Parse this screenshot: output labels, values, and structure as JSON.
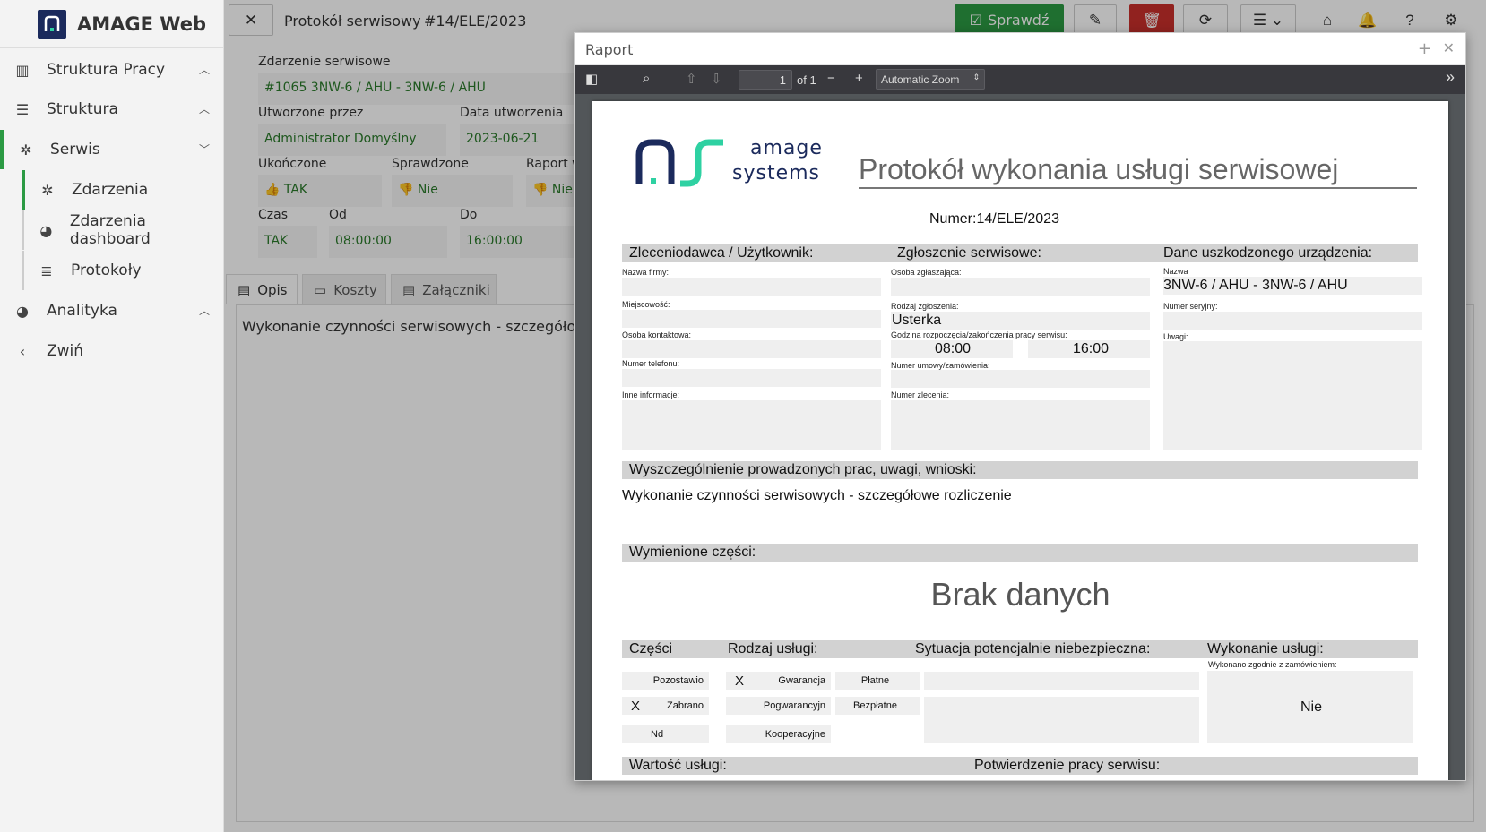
{
  "app": {
    "name": "AMAGE Web"
  },
  "sidebar": {
    "items": [
      {
        "label": "Struktura Pracy"
      },
      {
        "label": "Struktura"
      },
      {
        "label": "Serwis"
      },
      {
        "label": "Zdarzenia"
      },
      {
        "label": "Zdarzenia dashboard"
      },
      {
        "label": "Protokoły"
      },
      {
        "label": "Analityka"
      },
      {
        "label": "Zwiń"
      }
    ]
  },
  "header": {
    "title": "Protokół serwisowy",
    "number": "#14/ELE/2023",
    "check_label": "Sprawdź"
  },
  "form": {
    "event_label": "Zdarzenie serwisowe",
    "event_value": "#1065 3NW-6 / AHU - 3NW-6 / AHU",
    "created_by_label": "Utworzone przez",
    "created_by_value": "Administrator Domyślny",
    "created_date_label": "Data utworzenia",
    "created_date_value": "2023-06-21",
    "finished_label": "Ukończone",
    "finished_value": "TAK",
    "checked_label": "Sprawdzone",
    "checked_value": "Nie",
    "report_label": "Raport w",
    "report_value": "Nie",
    "time_label": "Czas",
    "time_value": "TAK",
    "from_label": "Od",
    "from_value": "08:00:00",
    "to_label": "Do",
    "to_value": "16:00:00"
  },
  "tabs": [
    {
      "label": "Opis"
    },
    {
      "label": "Koszty"
    },
    {
      "label": "Załączniki"
    }
  ],
  "description_text": "Wykonanie czynności serwisowych - szczegółowe r",
  "modal": {
    "title": "Raport",
    "page_input": "1",
    "page_of": "of 1",
    "zoom": "Automatic Zoom"
  },
  "pdf": {
    "logo_top": "amage",
    "logo_bottom": "systems",
    "title": "Protokół wykonania usługi serwisowej",
    "number": "Numer:14/ELE/2023",
    "sec_client": "Zleceniodawca / Użytkownik:",
    "sec_request": "Zgłoszenie serwisowe:",
    "sec_device": "Dane uszkodzonego urządzenia:",
    "company_name": "Nazwa firmy:",
    "city": "Miejscowość:",
    "contact": "Osoba kontaktowa:",
    "phone": "Numer telefonu:",
    "other_info": "Inne informacje:",
    "reporter": "Osoba zgłaszająca:",
    "request_type": "Rodzaj zgłoszenia:",
    "request_type_value": "Usterka",
    "work_hours": "Godzina rozpoczęcia/zakończenia pracy serwisu:",
    "start": "08:00",
    "end": "16:00",
    "contract_no": "Numer umowy/zamówienia:",
    "order_no": "Numer zlecenia:",
    "device_name": "Nazwa",
    "device_name_value": "3NW-6 / AHU - 3NW-6 / AHU",
    "serial": "Numer seryjny:",
    "notes": "Uwagi:",
    "sec_works": "Wyszczególnienie prowadzonych prac, uwagi, wnioski:",
    "works_text": "Wykonanie czynności serwisowych - szczegółowe rozliczenie",
    "sec_parts": "Wymienione części:",
    "no_data": "Brak danych",
    "parts_h": "Części",
    "service_type_h": "Rodzaj usługi:",
    "danger_h": "Sytuacja potencjalnie niebezpieczna:",
    "execution_h": "Wykonanie usługi:",
    "left": "Pozostawio",
    "taken": "Zabrano",
    "nd": "Nd",
    "warranty": "Gwarancja",
    "post_warranty": "Pogwarancyjn",
    "coop": "Kooperacyjne",
    "paid": "Płatne",
    "free": "Bezpłatne",
    "done_as_ordered": "Wykonano zgodnie z zamówieniem:",
    "done_value": "Nie",
    "mark": "X",
    "value_h": "Wartość usługi:",
    "confirm_h": "Potwierdzenie pracy serwisu:"
  },
  "colors": {
    "accent_green": "#2b9a43",
    "danger_red": "#c9302c",
    "brand_navy": "#1b2a5c",
    "logo_teal": "#2ed1a2"
  }
}
